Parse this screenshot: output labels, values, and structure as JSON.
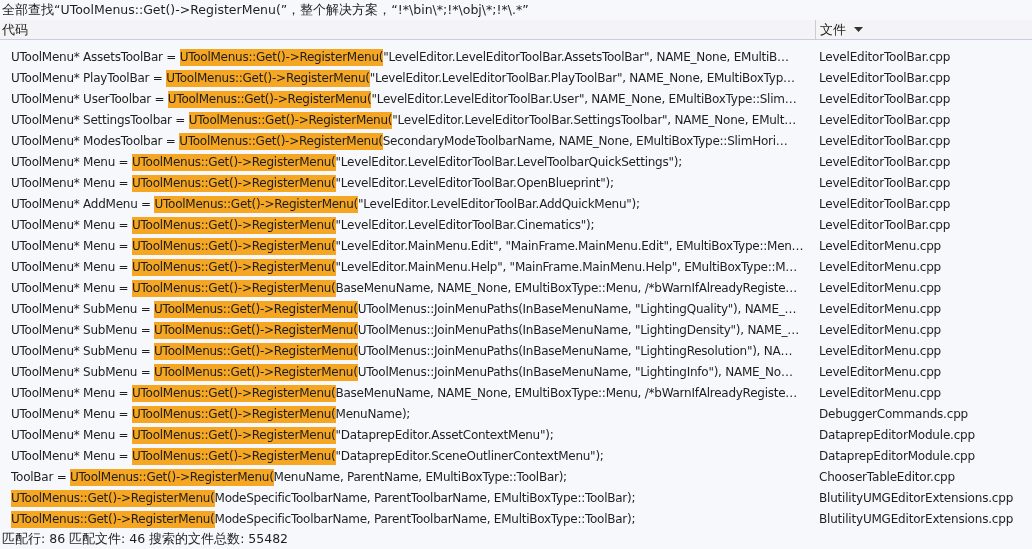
{
  "search_title": "全部查找“UToolMenus::Get()->RegisterMenu(”，整个解决方案，“!*\\bin\\*;!*\\obj\\*;!*\\.*”",
  "columns": [
    {
      "label": "代码",
      "sorted": false
    },
    {
      "label": "文件",
      "sorted": true
    }
  ],
  "rows": [
    {
      "prefix": "UToolMenu* AssetsToolBar = ",
      "match": "UToolMenus::Get()->RegisterMenu(",
      "rest": "\"LevelEditor.LevelEditorToolBar.AssetsToolBar\", NAME_None, EMultiB…",
      "file": "LevelEditorToolBar.cpp"
    },
    {
      "prefix": "UToolMenu* PlayToolBar = ",
      "match": "UToolMenus::Get()->RegisterMenu(",
      "rest": "\"LevelEditor.LevelEditorToolBar.PlayToolBar\", NAME_None, EMultiBoxTyp…",
      "file": "LevelEditorToolBar.cpp"
    },
    {
      "prefix": "UToolMenu* UserToolbar = ",
      "match": "UToolMenus::Get()->RegisterMenu(",
      "rest": "\"LevelEditor.LevelEditorToolBar.User\", NAME_None, EMultiBoxType::Slim…",
      "file": "LevelEditorToolBar.cpp"
    },
    {
      "prefix": "UToolMenu* SettingsToolbar = ",
      "match": "UToolMenus::Get()->RegisterMenu(",
      "rest": "\"LevelEditor.LevelEditorToolBar.SettingsToolbar\", NAME_None, EMult…",
      "file": "LevelEditorToolBar.cpp"
    },
    {
      "prefix": "UToolMenu* ModesToolbar = ",
      "match": "UToolMenus::Get()->RegisterMenu(",
      "rest": "SecondaryModeToolbarName, NAME_None, EMultiBoxType::SlimHori…",
      "file": "LevelEditorToolBar.cpp"
    },
    {
      "prefix": "UToolMenu* Menu = ",
      "match": "UToolMenus::Get()->RegisterMenu(",
      "rest": "\"LevelEditor.LevelEditorToolBar.LevelToolbarQuickSettings\");",
      "file": "LevelEditorToolBar.cpp"
    },
    {
      "prefix": "UToolMenu* Menu = ",
      "match": "UToolMenus::Get()->RegisterMenu(",
      "rest": "\"LevelEditor.LevelEditorToolBar.OpenBlueprint\");",
      "file": "LevelEditorToolBar.cpp"
    },
    {
      "prefix": "UToolMenu* AddMenu = ",
      "match": "UToolMenus::Get()->RegisterMenu(",
      "rest": "\"LevelEditor.LevelEditorToolBar.AddQuickMenu\");",
      "file": "LevelEditorToolBar.cpp"
    },
    {
      "prefix": "UToolMenu* Menu = ",
      "match": "UToolMenus::Get()->RegisterMenu(",
      "rest": "\"LevelEditor.LevelEditorToolBar.Cinematics\");",
      "file": "LevelEditorToolBar.cpp"
    },
    {
      "prefix": "UToolMenu* Menu = ",
      "match": "UToolMenus::Get()->RegisterMenu(",
      "rest": "\"LevelEditor.MainMenu.Edit\", \"MainFrame.MainMenu.Edit\", EMultiBoxType::Men…",
      "file": "LevelEditorMenu.cpp"
    },
    {
      "prefix": "UToolMenu* Menu = ",
      "match": "UToolMenus::Get()->RegisterMenu(",
      "rest": "\"LevelEditor.MainMenu.Help\", \"MainFrame.MainMenu.Help\", EMultiBoxType::M…",
      "file": "LevelEditorMenu.cpp"
    },
    {
      "prefix": "UToolMenu* Menu = ",
      "match": "UToolMenus::Get()->RegisterMenu(",
      "rest": "BaseMenuName, NAME_None, EMultiBoxType::Menu, /*bWarnIfAlreadyRegiste…",
      "file": "LevelEditorMenu.cpp"
    },
    {
      "prefix": "UToolMenu* SubMenu = ",
      "match": "UToolMenus::Get()->RegisterMenu(",
      "rest": "UToolMenus::JoinMenuPaths(InBaseMenuName, \"LightingQuality\"), NAME_…",
      "file": "LevelEditorMenu.cpp"
    },
    {
      "prefix": "UToolMenu* SubMenu = ",
      "match": "UToolMenus::Get()->RegisterMenu(",
      "rest": "UToolMenus::JoinMenuPaths(InBaseMenuName, \"LightingDensity\"), NAME_…",
      "file": "LevelEditorMenu.cpp"
    },
    {
      "prefix": "UToolMenu* SubMenu = ",
      "match": "UToolMenus::Get()->RegisterMenu(",
      "rest": "UToolMenus::JoinMenuPaths(InBaseMenuName, \"LightingResolution\"), NA…",
      "file": "LevelEditorMenu.cpp"
    },
    {
      "prefix": "UToolMenu* SubMenu = ",
      "match": "UToolMenus::Get()->RegisterMenu(",
      "rest": "UToolMenus::JoinMenuPaths(InBaseMenuName, \"LightingInfo\"), NAME_No…",
      "file": "LevelEditorMenu.cpp"
    },
    {
      "prefix": "UToolMenu* Menu = ",
      "match": "UToolMenus::Get()->RegisterMenu(",
      "rest": "BaseMenuName, NAME_None, EMultiBoxType::Menu, /*bWarnIfAlreadyRegiste…",
      "file": "LevelEditorMenu.cpp"
    },
    {
      "prefix": "UToolMenu* Menu = ",
      "match": "UToolMenus::Get()->RegisterMenu(",
      "rest": "MenuName);",
      "file": "DebuggerCommands.cpp"
    },
    {
      "prefix": "UToolMenu* Menu = ",
      "match": "UToolMenus::Get()->RegisterMenu(",
      "rest": "\"DataprepEditor.AssetContextMenu\");",
      "file": "DataprepEditorModule.cpp"
    },
    {
      "prefix": "UToolMenu* Menu = ",
      "match": "UToolMenus::Get()->RegisterMenu(",
      "rest": "\"DataprepEditor.SceneOutlinerContextMenu\");",
      "file": "DataprepEditorModule.cpp"
    },
    {
      "prefix": "ToolBar = ",
      "match": "UToolMenus::Get()->RegisterMenu(",
      "rest": "MenuName, ParentName, EMultiBoxType::ToolBar);",
      "file": "ChooserTableEditor.cpp"
    },
    {
      "prefix": "",
      "match": "UToolMenus::Get()->RegisterMenu(",
      "rest": "ModeSpecificToolbarName, ParentToolbarName, EMultiBoxType::ToolBar);",
      "file": "BlutilityUMGEditorExtensions.cpp"
    },
    {
      "prefix": "",
      "match": "UToolMenus::Get()->RegisterMenu(",
      "rest": "ModeSpecificToolbarName, ParentToolbarName, EMultiBoxType::ToolBar);",
      "file": "BlutilityUMGEditorExtensions.cpp"
    }
  ],
  "status": "匹配行: 86 匹配文件: 46 搜索的文件总数: 55482"
}
